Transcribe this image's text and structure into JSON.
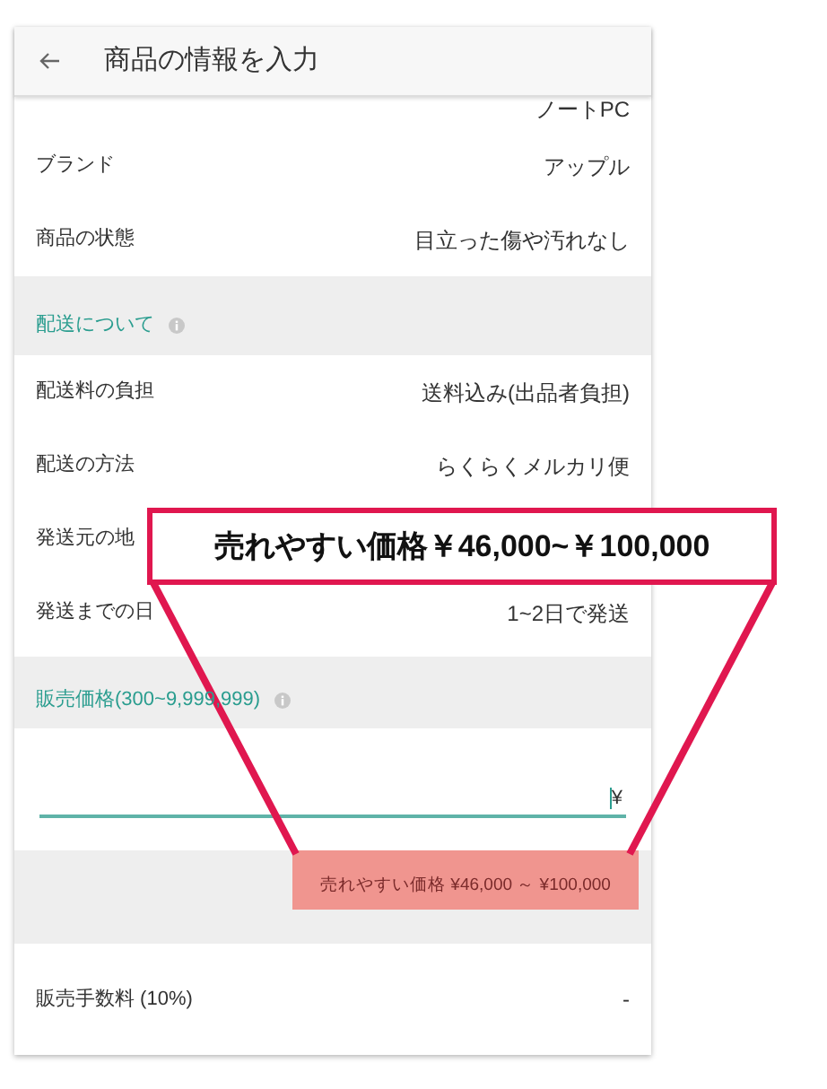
{
  "header": {
    "title": "商品の情報を入力"
  },
  "top_value": "ノートPC",
  "item_rows": [
    {
      "label": "ブランド",
      "value": "アップル"
    },
    {
      "label": "商品の状態",
      "value": "目立った傷や汚れなし"
    }
  ],
  "shipping": {
    "heading": "配送について",
    "rows": [
      {
        "label": "配送料の負担",
        "value": "送料込み(出品者負担)"
      },
      {
        "label": "配送の方法",
        "value": "らくらくメルカリ便"
      },
      {
        "label": "発送元の地"
      },
      {
        "label": "発送までの日",
        "value": "1~2日で発送"
      }
    ]
  },
  "price": {
    "heading": "販売価格(300~9,999,999)",
    "currency": "¥",
    "hint": "売れやすい価格 ¥46,000 ～ ¥100,000"
  },
  "fee": {
    "label": "販売手数料 (10%)",
    "value": "-"
  },
  "callout": "売れやすい価格￥46,000~￥100,000"
}
